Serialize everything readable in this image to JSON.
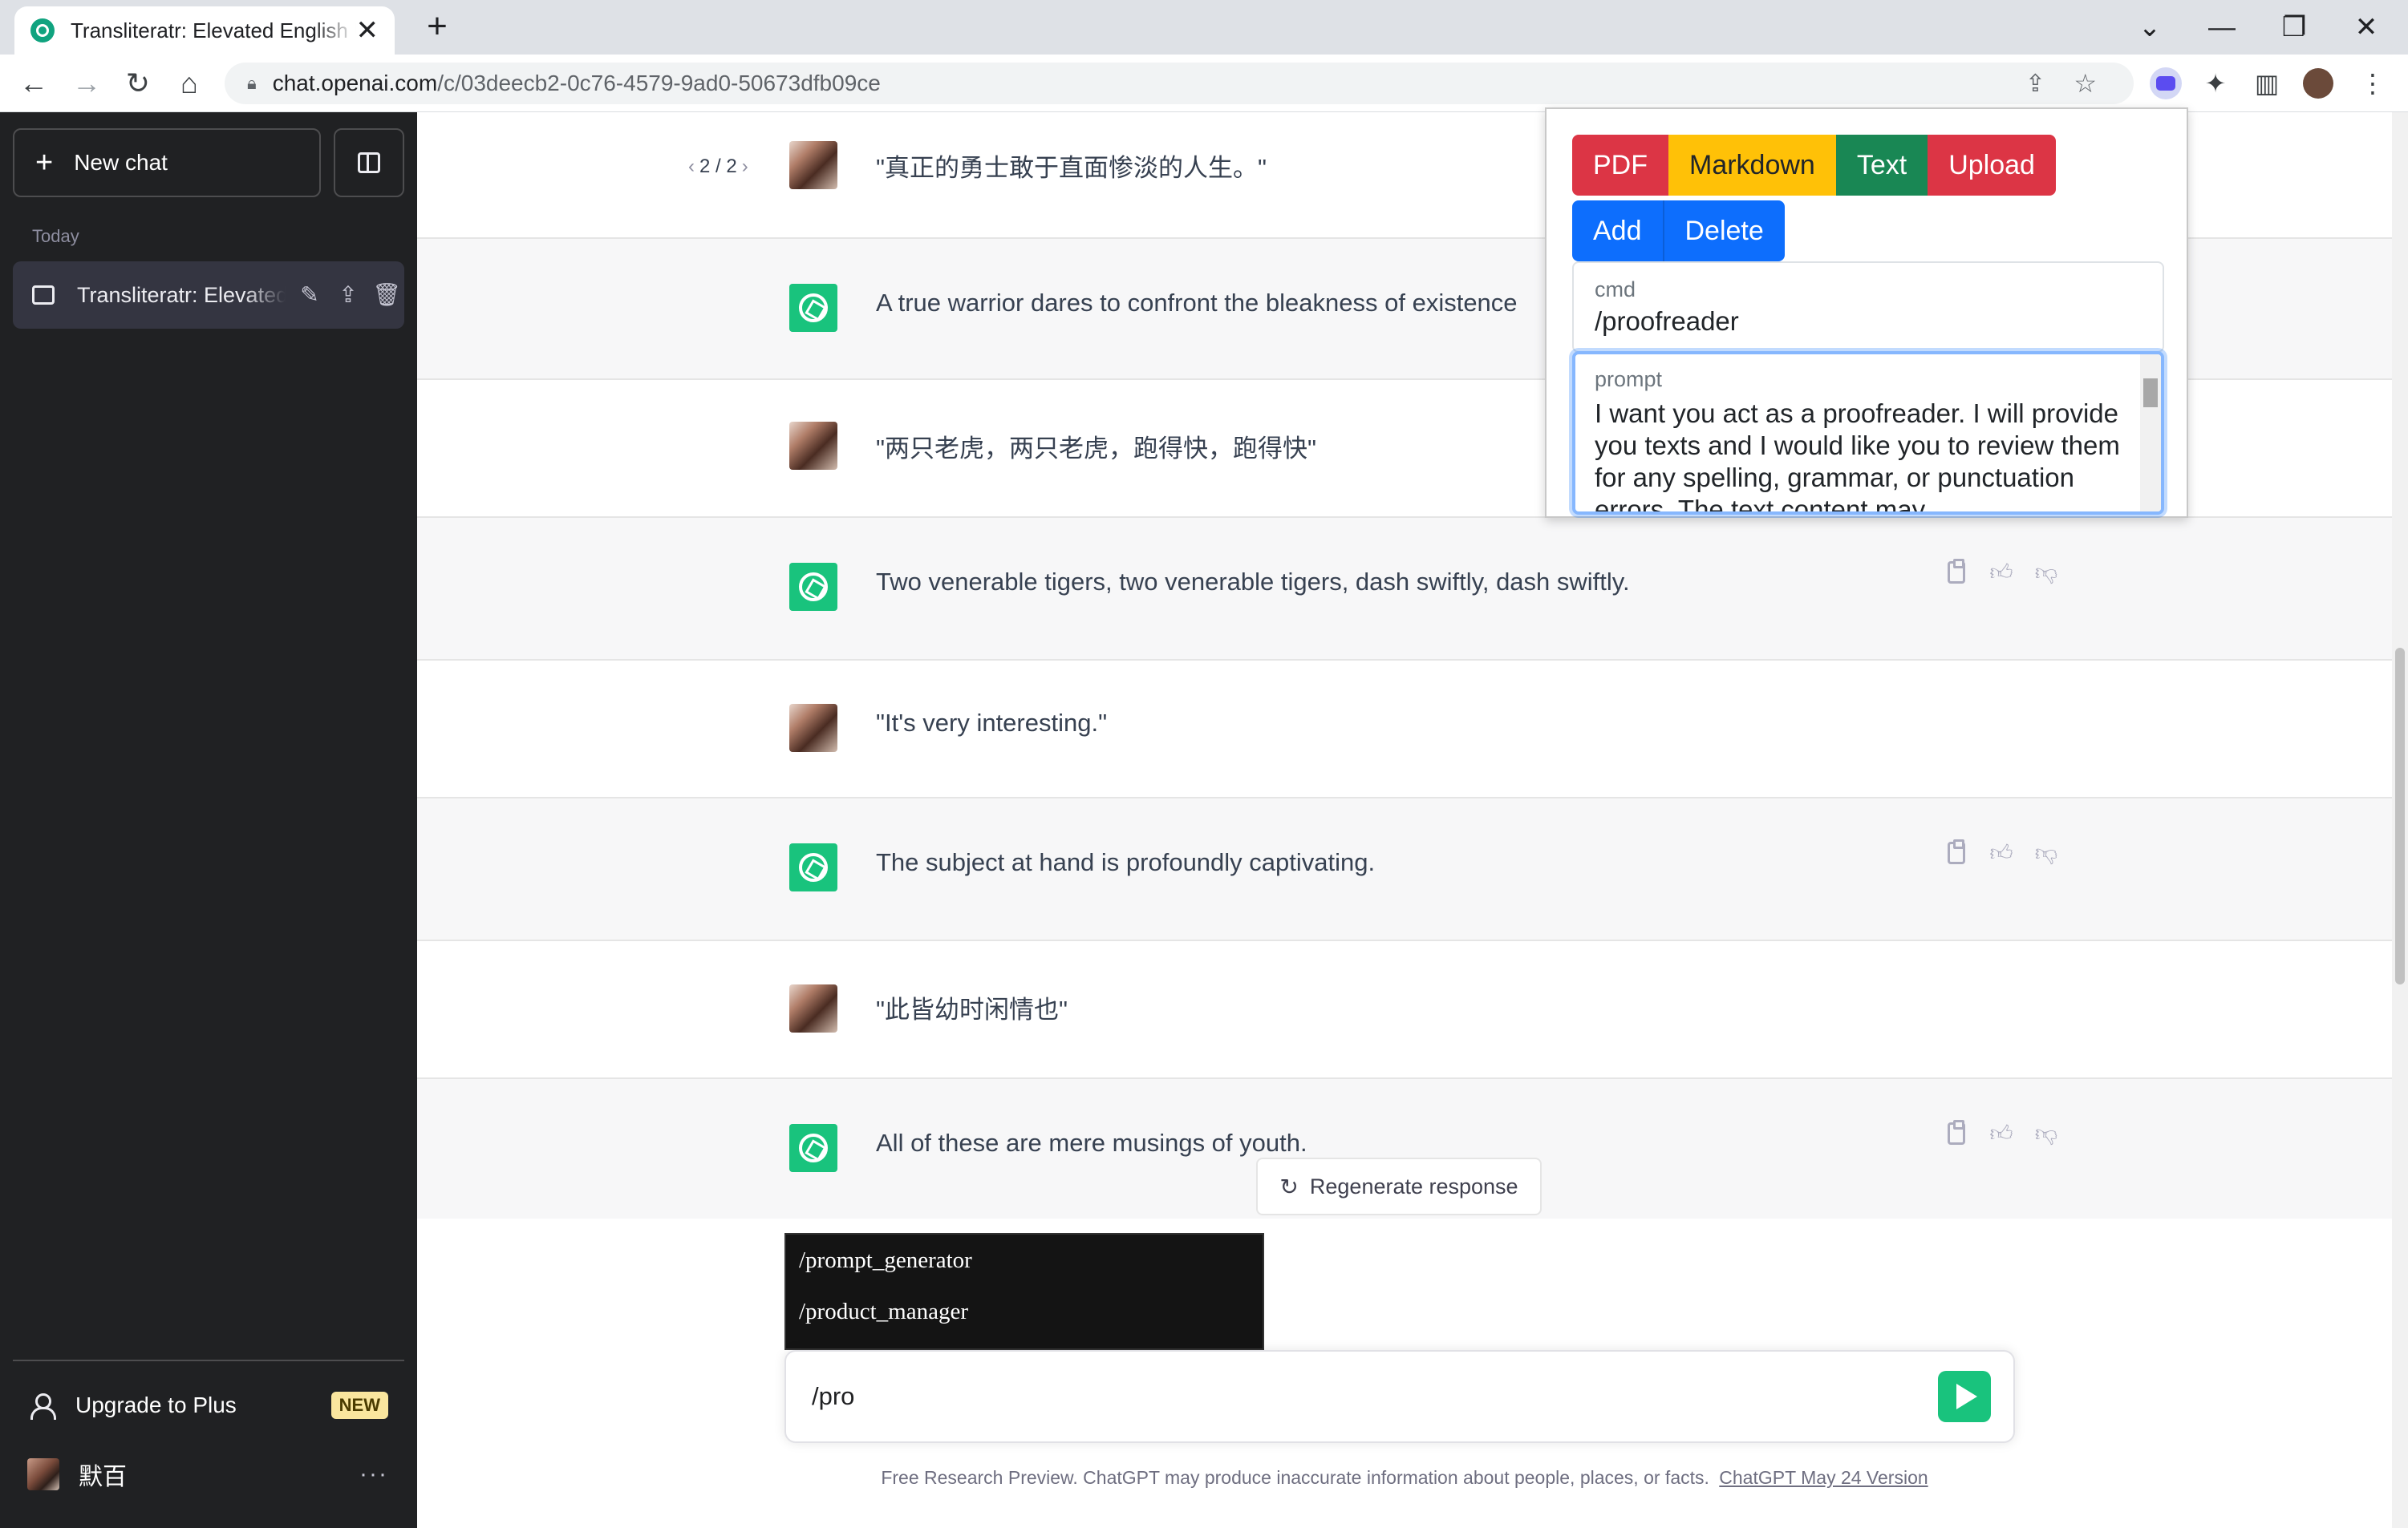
{
  "browser": {
    "tab_title": "Transliteratr: Elevated English U",
    "tab_close": "✕",
    "new_tab": "+",
    "win_min": "—",
    "win_restore": "❐",
    "win_close": "✕",
    "win_collapse": "⌄",
    "url_host": "chat.openai.com",
    "url_path": "/c/03deecb2-0c76-4579-9ad0-50673dfb09ce"
  },
  "sidebar": {
    "new_chat_label": "New chat",
    "today_label": "Today",
    "history": [
      {
        "title": "Transliteratr: Elevated English"
      }
    ],
    "upgrade_label": "Upgrade to Plus",
    "new_badge": "NEW",
    "user_name": "默百",
    "more": "···"
  },
  "chat": {
    "pager": "2 / 2",
    "messages": [
      {
        "role": "user",
        "text": "\"真正的勇士敢于直面惨淡的人生。\""
      },
      {
        "role": "assistant",
        "text": "A true warrior dares to confront the bleakness of existence"
      },
      {
        "role": "user",
        "text": "\"两只老虎，两只老虎，跑得快，跑得快\""
      },
      {
        "role": "assistant",
        "text": "Two venerable tigers, two venerable tigers, dash swiftly, dash swiftly."
      },
      {
        "role": "user",
        "text": "\"It's very interesting.\""
      },
      {
        "role": "assistant",
        "text": "The subject at hand is profoundly captivating."
      },
      {
        "role": "user",
        "text": "\"此皆幼时闲情也\""
      },
      {
        "role": "assistant",
        "text": "All of these are mere musings of youth."
      }
    ],
    "regenerate_label": "Regenerate response",
    "suggestions": [
      "/prompt_generator",
      "/product_manager"
    ],
    "input_value": "/pro",
    "footer_text": "Free Research Preview. ChatGPT may produce inaccurate information about people, places, or facts.",
    "footer_link": "ChatGPT May 24 Version"
  },
  "extension": {
    "buttons_row1": [
      "PDF",
      "Markdown",
      "Text",
      "Upload"
    ],
    "buttons_row2": [
      "Add",
      "Delete"
    ],
    "cmd_label": "cmd",
    "cmd_value": "/proofreader",
    "prompt_label": "prompt",
    "prompt_value": "I want you act as a proofreader. I will provide you texts and I would like you to review them for any spelling, grammar, or punctuation errors. The text content may"
  },
  "colors": {
    "sidebar_bg": "#202123",
    "gpt_green": "#19c37d",
    "pdf_red": "#dc3545",
    "markdown_yellow": "#ffc107",
    "text_green": "#198754",
    "add_blue": "#0d6efd"
  }
}
